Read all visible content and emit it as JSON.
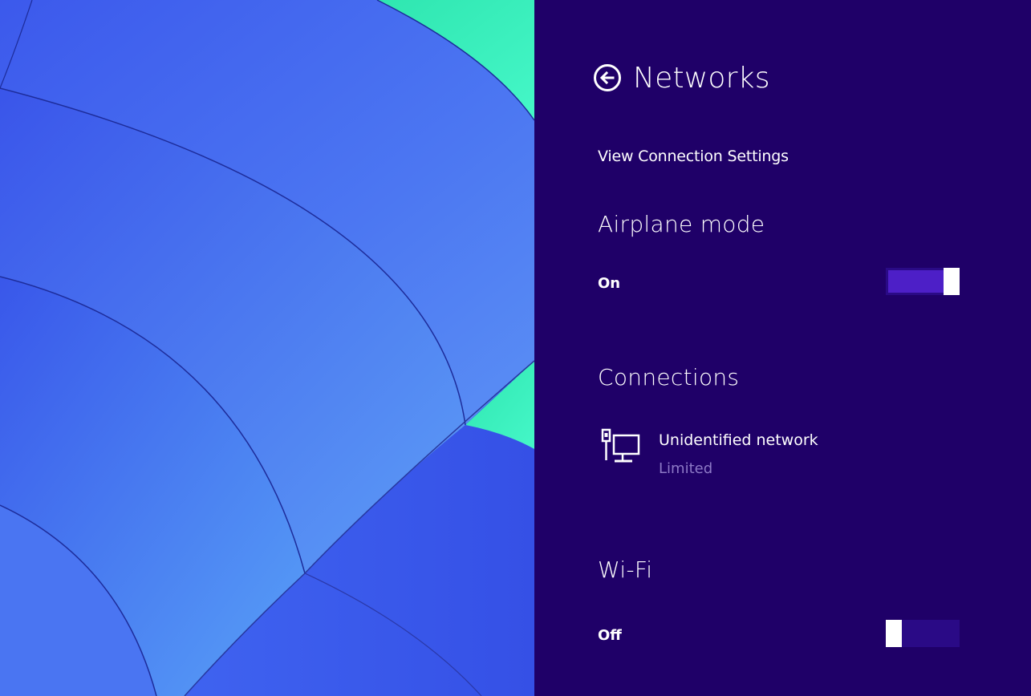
{
  "panel": {
    "title": "Networks",
    "view_settings_link": "View Connection Settings"
  },
  "airplane_mode": {
    "heading": "Airplane mode",
    "state_label": "On",
    "on": true
  },
  "connections": {
    "heading": "Connections",
    "items": [
      {
        "name": "Unidentified network",
        "status": "Limited",
        "icon": "wired-network-icon"
      }
    ]
  },
  "wifi": {
    "heading": "Wi-Fi",
    "state_label": "Off",
    "on": false
  },
  "colors": {
    "panel_background": "#1f0068",
    "toggle_fill": "#4d1fc7",
    "secondary_text": "#8d79c6",
    "wallpaper_blue": "#3f64f0",
    "wallpaper_teal": "#38f2bd"
  }
}
